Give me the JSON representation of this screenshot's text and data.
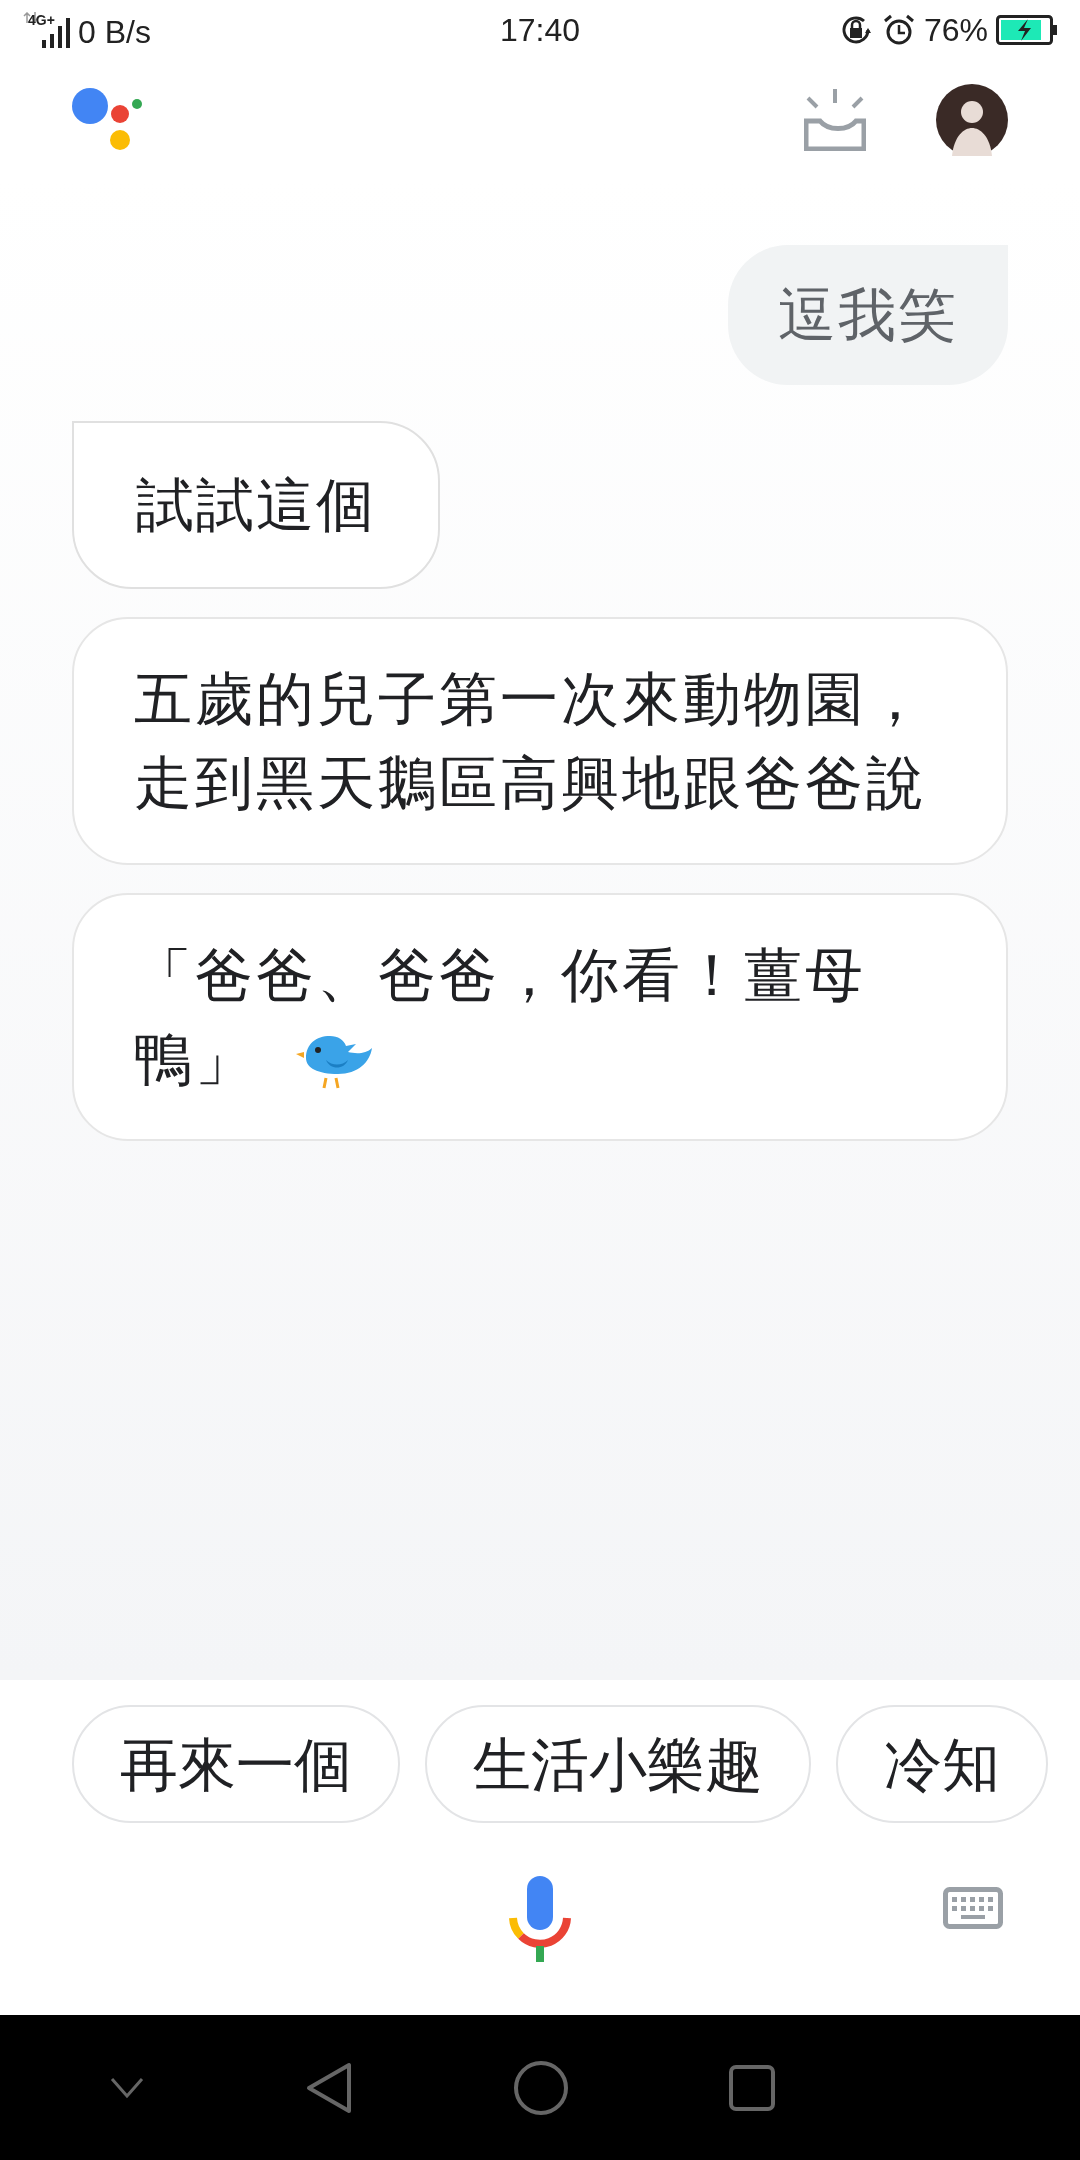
{
  "status_bar": {
    "network": "4G+",
    "speed": "0 B/s",
    "time": "17:40",
    "battery": "76%"
  },
  "messages": [
    {
      "kind": "user",
      "text": "逗我笑"
    },
    {
      "kind": "reply",
      "text": "試試這個"
    },
    {
      "kind": "card",
      "text": "五歲的兒子第一次來動物園，走到黑天鵝區高興地跟爸爸說"
    },
    {
      "kind": "card",
      "lines": [
        "「爸爸、爸爸，你看！薑母",
        "鴨」"
      ],
      "bird": true
    }
  ],
  "suggestions": [
    "再來一個",
    "生活小樂趣",
    "冷知"
  ]
}
